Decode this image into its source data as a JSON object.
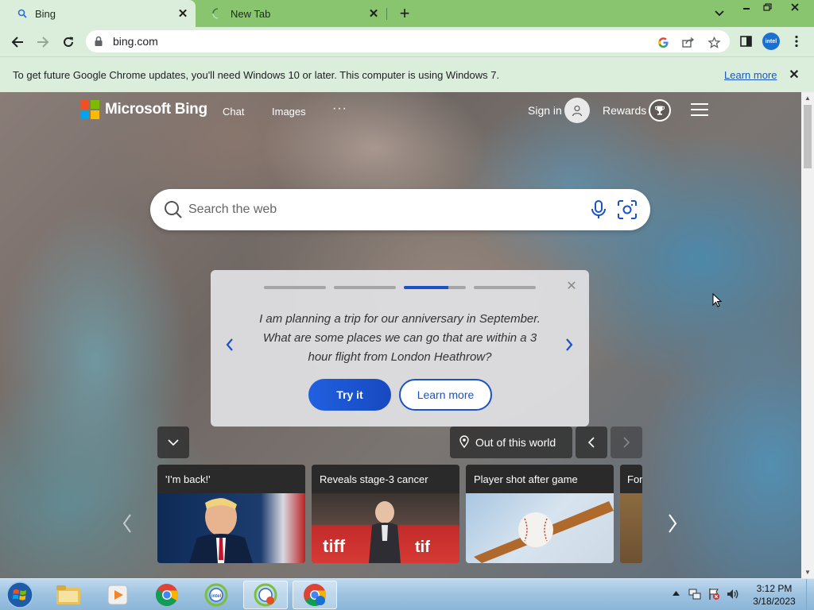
{
  "browser": {
    "tabs": [
      {
        "title": "Bing",
        "active": true
      },
      {
        "title": "New Tab",
        "active": false
      }
    ],
    "new_tab_label": "+",
    "address": "bing.com",
    "profile_label": "intel"
  },
  "infobar": {
    "message": "To get future Google Chrome updates, you'll need Windows 10 or later. This computer is using Windows 7.",
    "link": "Learn more",
    "close": "✕"
  },
  "bing": {
    "logo_text": "Microsoft Bing",
    "nav": [
      "Chat",
      "Images"
    ],
    "more": "···",
    "sign_in": "Sign in",
    "rewards": "Rewards",
    "search_placeholder": "Search the web",
    "card": {
      "progress": [
        1,
        1,
        0.72,
        0
      ],
      "text": "I am planning a trip for our anniversary in September. What are some places we can go that are within a 3 hour flight from London Heathrow?",
      "try_it": "Try it",
      "learn_more": "Learn more"
    },
    "location": "Out of this world",
    "news": [
      {
        "title": "'I'm back!'"
      },
      {
        "title": "Reveals stage-3 cancer"
      },
      {
        "title": "Player shot after game"
      },
      {
        "title": "Fort"
      }
    ]
  },
  "taskbar": {
    "apps": [
      "start",
      "file-explorer",
      "media-player",
      "chrome",
      "intel-app",
      "intel-app-2",
      "chrome-intel"
    ],
    "time": "3:12 PM",
    "date": "3/18/2023"
  },
  "colors": {
    "tab_strip": "#89c46f",
    "toolbar": "#dbeedc",
    "bing_blue": "#1a53c7"
  }
}
